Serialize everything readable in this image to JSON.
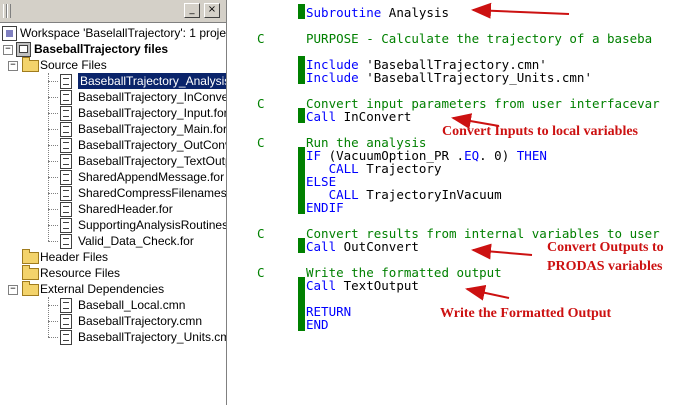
{
  "workspace_pane": {
    "buttons": {
      "minimize": "_",
      "close": "×"
    },
    "tree": [
      {
        "id": "workspace",
        "label": "Workspace 'BaselallTrajectory': 1 project(",
        "level": 0,
        "icon": "workspace-icon",
        "expander": ""
      },
      {
        "id": "project",
        "label": "BaseballTrajectory files",
        "level": 0,
        "icon": "project-icon",
        "expander": "−",
        "bold": true
      },
      {
        "id": "source-files",
        "label": "Source Files",
        "level": 1,
        "icon": "folder-open-icon",
        "expander": "−"
      },
      {
        "id": "f1",
        "label": "BaseballTrajectory_Analysis.fo",
        "level": 2,
        "icon": "file-icon",
        "selected": true
      },
      {
        "id": "f2",
        "label": "BaseballTrajectory_InConvert.",
        "level": 2,
        "icon": "file-icon"
      },
      {
        "id": "f3",
        "label": "BaseballTrajectory_Input.for",
        "level": 2,
        "icon": "file-icon"
      },
      {
        "id": "f4",
        "label": "BaseballTrajectory_Main.for",
        "level": 2,
        "icon": "file-icon"
      },
      {
        "id": "f5",
        "label": "BaseballTrajectory_OutConve",
        "level": 2,
        "icon": "file-icon"
      },
      {
        "id": "f6",
        "label": "BaseballTrajectory_TextOutpu",
        "level": 2,
        "icon": "file-icon"
      },
      {
        "id": "f7",
        "label": "SharedAppendMessage.for",
        "level": 2,
        "icon": "file-icon"
      },
      {
        "id": "f8",
        "label": "SharedCompressFilenames.for",
        "level": 2,
        "icon": "file-icon"
      },
      {
        "id": "f9",
        "label": "SharedHeader.for",
        "level": 2,
        "icon": "file-icon"
      },
      {
        "id": "f10",
        "label": "SupportingAnalysisRoutines.fo",
        "level": 2,
        "icon": "file-icon"
      },
      {
        "id": "f11",
        "label": "Valid_Data_Check.for",
        "level": 2,
        "icon": "file-icon"
      },
      {
        "id": "header-files",
        "label": "Header Files",
        "level": 1,
        "icon": "folder-icon",
        "expander": ""
      },
      {
        "id": "resource-files",
        "label": "Resource Files",
        "level": 1,
        "icon": "folder-icon",
        "expander": ""
      },
      {
        "id": "external-deps",
        "label": "External Dependencies",
        "level": 1,
        "icon": "folder-open-icon",
        "expander": "−"
      },
      {
        "id": "e1",
        "label": "Baseball_Local.cmn",
        "level": 2,
        "icon": "file-icon"
      },
      {
        "id": "e2",
        "label": "BaseballTrajectory.cmn",
        "level": 2,
        "icon": "file-icon"
      },
      {
        "id": "e3",
        "label": "BaseballTrajectory_Units.cmn",
        "level": 2,
        "icon": "file-icon"
      }
    ]
  },
  "editor": {
    "lines": [
      {
        "c": "",
        "parts": [
          [
            "kw",
            "Subroutine"
          ],
          [
            "pl",
            " Analysis"
          ]
        ]
      },
      {
        "c": "",
        "parts": []
      },
      {
        "c": "C",
        "parts": [
          [
            "cm",
            "PURPOSE - Calculate the trajectory of a baseba"
          ]
        ]
      },
      {
        "c": "",
        "parts": []
      },
      {
        "c": "",
        "parts": [
          [
            "kw",
            "Include"
          ],
          [
            "pl",
            " 'BaseballTrajectory.cmn'"
          ]
        ]
      },
      {
        "c": "",
        "parts": [
          [
            "kw",
            "Include"
          ],
          [
            "pl",
            " 'BaseballTrajectory_Units.cmn'"
          ]
        ]
      },
      {
        "c": "",
        "parts": []
      },
      {
        "c": "C",
        "parts": [
          [
            "cm",
            "Convert input parameters from user interfacevar"
          ]
        ]
      },
      {
        "c": "",
        "parts": [
          [
            "kw",
            "Call"
          ],
          [
            "pl",
            " InConvert"
          ]
        ]
      },
      {
        "c": "",
        "parts": []
      },
      {
        "c": "C",
        "parts": [
          [
            "cm",
            "Run the analysis"
          ]
        ]
      },
      {
        "c": "",
        "parts": [
          [
            "kw",
            "IF"
          ],
          [
            "pl",
            " (VacuumOption_PR ."
          ],
          [
            "kw",
            "EQ"
          ],
          [
            "pl",
            ". 0) "
          ],
          [
            "kw",
            "THEN"
          ]
        ]
      },
      {
        "c": "",
        "parts": [
          [
            "pl",
            "   "
          ],
          [
            "kw",
            "CALL"
          ],
          [
            "pl",
            " Trajectory"
          ]
        ]
      },
      {
        "c": "",
        "parts": [
          [
            "kw",
            "ELSE"
          ]
        ]
      },
      {
        "c": "",
        "parts": [
          [
            "pl",
            "   "
          ],
          [
            "kw",
            "CALL"
          ],
          [
            "pl",
            " TrajectoryInVacuum"
          ]
        ]
      },
      {
        "c": "",
        "parts": [
          [
            "kw",
            "ENDIF"
          ]
        ]
      },
      {
        "c": "",
        "parts": []
      },
      {
        "c": "C",
        "parts": [
          [
            "cm",
            "Convert results from internal variables to user"
          ]
        ]
      },
      {
        "c": "",
        "parts": [
          [
            "kw",
            "Call"
          ],
          [
            "pl",
            " OutConvert"
          ]
        ]
      },
      {
        "c": "",
        "parts": []
      },
      {
        "c": "C",
        "parts": [
          [
            "cm",
            "Write the formatted output"
          ]
        ]
      },
      {
        "c": "",
        "parts": [
          [
            "kw",
            "Call"
          ],
          [
            "pl",
            " TextOutput"
          ]
        ]
      },
      {
        "c": "",
        "parts": []
      },
      {
        "c": "",
        "parts": [
          [
            "kw",
            "RETURN"
          ]
        ]
      },
      {
        "c": "",
        "parts": [
          [
            "kw",
            "END"
          ]
        ]
      }
    ],
    "annotations": {
      "inputs": "Convert Inputs to local variables",
      "outputs_line1": "Convert Outputs to",
      "outputs_line2": "PRODAS variables",
      "formatted": "Write the Formatted Output"
    }
  },
  "colors": {
    "keyword": "#0000ff",
    "comment": "#008000",
    "annotation": "#cc1111",
    "selection": "#0a246a"
  }
}
